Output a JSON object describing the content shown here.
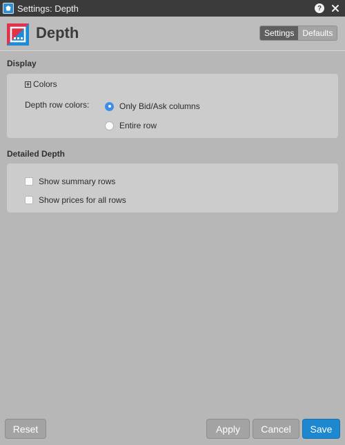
{
  "window": {
    "title": "Settings: Depth",
    "help_symbol": "?"
  },
  "header": {
    "title": "Depth",
    "tabs": [
      {
        "label": "Settings",
        "active": true
      },
      {
        "label": "Defaults",
        "active": false
      }
    ]
  },
  "display": {
    "section_title": "Display",
    "colors_toggle": {
      "symbol": "+",
      "label": "Colors"
    },
    "depth_row_colors_label": "Depth row colors:",
    "options": [
      {
        "label": "Only Bid/Ask columns",
        "selected": true
      },
      {
        "label": "Entire row",
        "selected": false
      }
    ]
  },
  "detailed_depth": {
    "section_title": "Detailed Depth",
    "checkboxes": [
      {
        "label": "Show summary rows",
        "checked": false
      },
      {
        "label": "Show prices for all rows",
        "checked": false
      }
    ]
  },
  "footer": {
    "reset_label": "Reset",
    "apply_label": "Apply",
    "cancel_label": "Cancel",
    "save_label": "Save"
  },
  "colors": {
    "accent": "#1d87cf",
    "radio_selected": "#3a8ee6",
    "titlebar": "#3b3b3b",
    "background": "#b7b7b7",
    "logo_red": "#e0334b",
    "logo_blue": "#1f8bd6"
  },
  "icons": {
    "app": "app-icon",
    "help": "help-icon",
    "close": "close-icon",
    "logo": "depth-logo-icon",
    "expand": "plus-icon"
  }
}
